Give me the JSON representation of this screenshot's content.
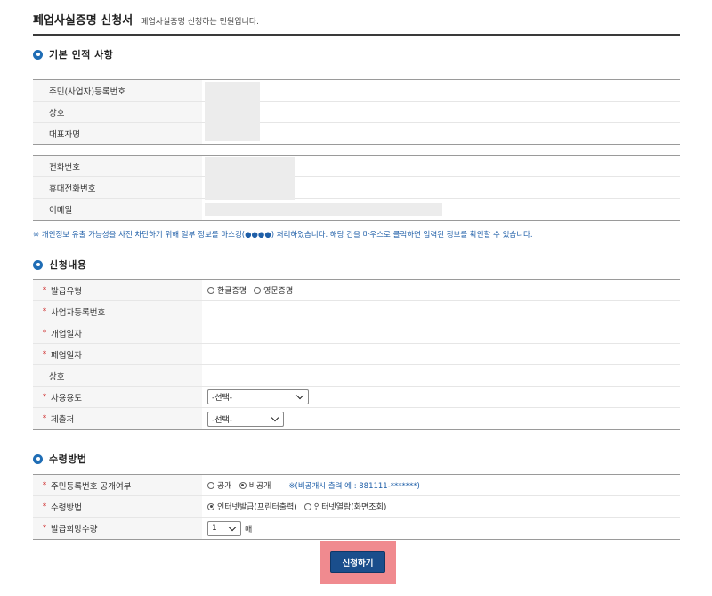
{
  "page": {
    "title": "폐업사실증명 신청서",
    "subtitle": "폐업사실증명 신청하는 민원입니다."
  },
  "basic_info": {
    "section_title": "기본 인적 사항",
    "group1": [
      {
        "label": "주민(사업자)등록번호",
        "value": ""
      },
      {
        "label": "상호",
        "value": ""
      },
      {
        "label": "대표자명",
        "value": ""
      }
    ],
    "group2": [
      {
        "label": "전화번호",
        "value": ""
      },
      {
        "label": "휴대전화번호",
        "value": ""
      },
      {
        "label": "이메일",
        "value": ""
      }
    ],
    "notice": "※ 개인정보 유출 가능성을 사전 차단하기 위해 일부 정보를 마스킹(●●●●) 처리하였습니다. 해당 칸을 마우스로 클릭하면 입력된 정보를 확인할 수 있습니다."
  },
  "application": {
    "section_title": "신청내용",
    "required_mark": "*",
    "issue_type": {
      "label": "발급유형",
      "options": [
        "한글증명",
        "영문증명"
      ],
      "selected": null
    },
    "biz_number": {
      "label": "사업자등록번호",
      "value": ""
    },
    "open_date": {
      "label": "개업일자",
      "value": ""
    },
    "close_date": {
      "label": "폐업일자",
      "value": ""
    },
    "company": {
      "label": "상호",
      "value": ""
    },
    "purpose": {
      "label": "사용용도",
      "selected": "-선택-"
    },
    "submit_to": {
      "label": "제출처",
      "selected": "-선택-"
    }
  },
  "receive": {
    "section_title": "수령방법",
    "disclosure": {
      "label": "주민등록번호 공개여부",
      "options": [
        "공개",
        "비공개"
      ],
      "selected": "비공개",
      "hint": "※(비공개시 출력 예 : 881111-*******)"
    },
    "method": {
      "label": "수령방법",
      "options": [
        "인터넷발급(프린터출력)",
        "인터넷열람(화면조회)"
      ],
      "selected": "인터넷발급(프린터출력)"
    },
    "quantity": {
      "label": "발급희망수량",
      "value": "1",
      "unit": "매"
    }
  },
  "submit_button": {
    "label": "신청하기",
    "highlight_color": "#f08a8f",
    "color": "#1a4e8c"
  }
}
